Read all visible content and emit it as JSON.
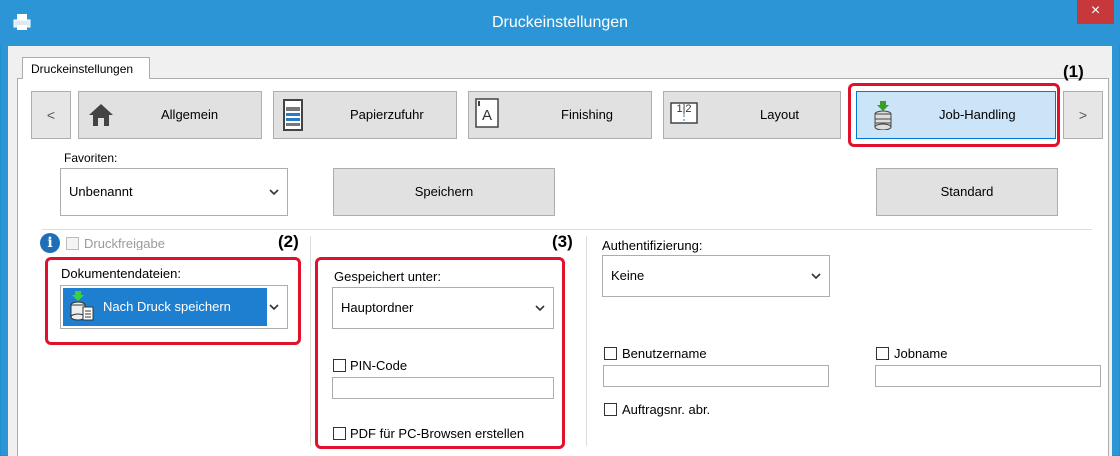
{
  "window": {
    "title": "Druckeinstellungen",
    "close_glyph": "×"
  },
  "tab": {
    "label": "Druckeinstellungen"
  },
  "nav": {
    "prev_glyph": "<",
    "next_glyph": ">",
    "items": [
      {
        "label": "Allgemein",
        "icon": "home-icon"
      },
      {
        "label": "Papierzufuhr",
        "icon": "paper-tray-icon"
      },
      {
        "label": "Finishing",
        "icon": "finishing-icon"
      },
      {
        "label": "Layout",
        "icon": "layout-icon",
        "icon_text": "1|2"
      },
      {
        "label": "Job-Handling",
        "icon": "job-handling-icon",
        "selected": true
      }
    ]
  },
  "favorites": {
    "label": "Favoriten:",
    "value": "Unbenannt",
    "save_label": "Speichern",
    "default_label": "Standard"
  },
  "print_release": {
    "label": "Druckfreigabe",
    "checked": false,
    "disabled": true
  },
  "document_filing": {
    "label": "Dokumentendateien:",
    "value": "Nach Druck speichern"
  },
  "stored_in": {
    "label": "Gespeichert unter:",
    "value": "Hauptordner"
  },
  "pin": {
    "label": "PIN-Code",
    "checked": false,
    "value": ""
  },
  "pdf": {
    "label": "PDF für PC-Browsen erstellen",
    "checked": false
  },
  "auth": {
    "label": "Authentifizierung:",
    "value": "Keine"
  },
  "username": {
    "label": "Benutzername",
    "checked": false,
    "value": ""
  },
  "jobname": {
    "label": "Jobname",
    "checked": false,
    "value": ""
  },
  "account": {
    "label": "Auftragsnr. abr.",
    "checked": false
  },
  "callouts": {
    "c1": "(1)",
    "c2": "(2)",
    "c3": "(3)"
  },
  "colors": {
    "title_bar": "#2b95d6",
    "callout_red": "#e0112b",
    "selected_blue": "#1e7fd0"
  }
}
